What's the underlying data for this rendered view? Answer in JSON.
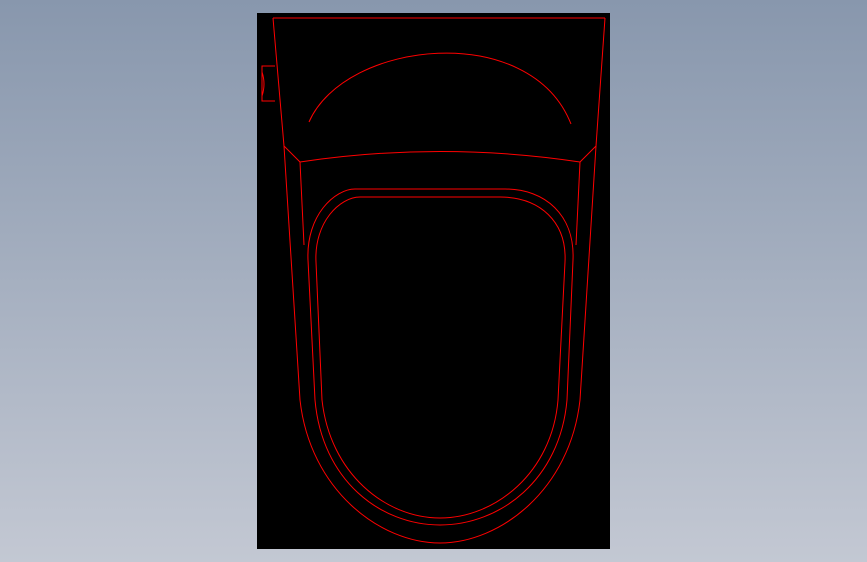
{
  "colors": {
    "background_top": "#8897ad",
    "background_bottom": "#c3c8d3",
    "viewport": "#000000",
    "stroke": "#ff0000"
  },
  "drawing": {
    "view": "front",
    "line_style": "wireframe",
    "entities": [
      "outer-body-outline",
      "top-edge",
      "side-tab",
      "top-arc",
      "shoulder-line",
      "outer-bowl-rim",
      "inner-bowl-rim"
    ]
  }
}
